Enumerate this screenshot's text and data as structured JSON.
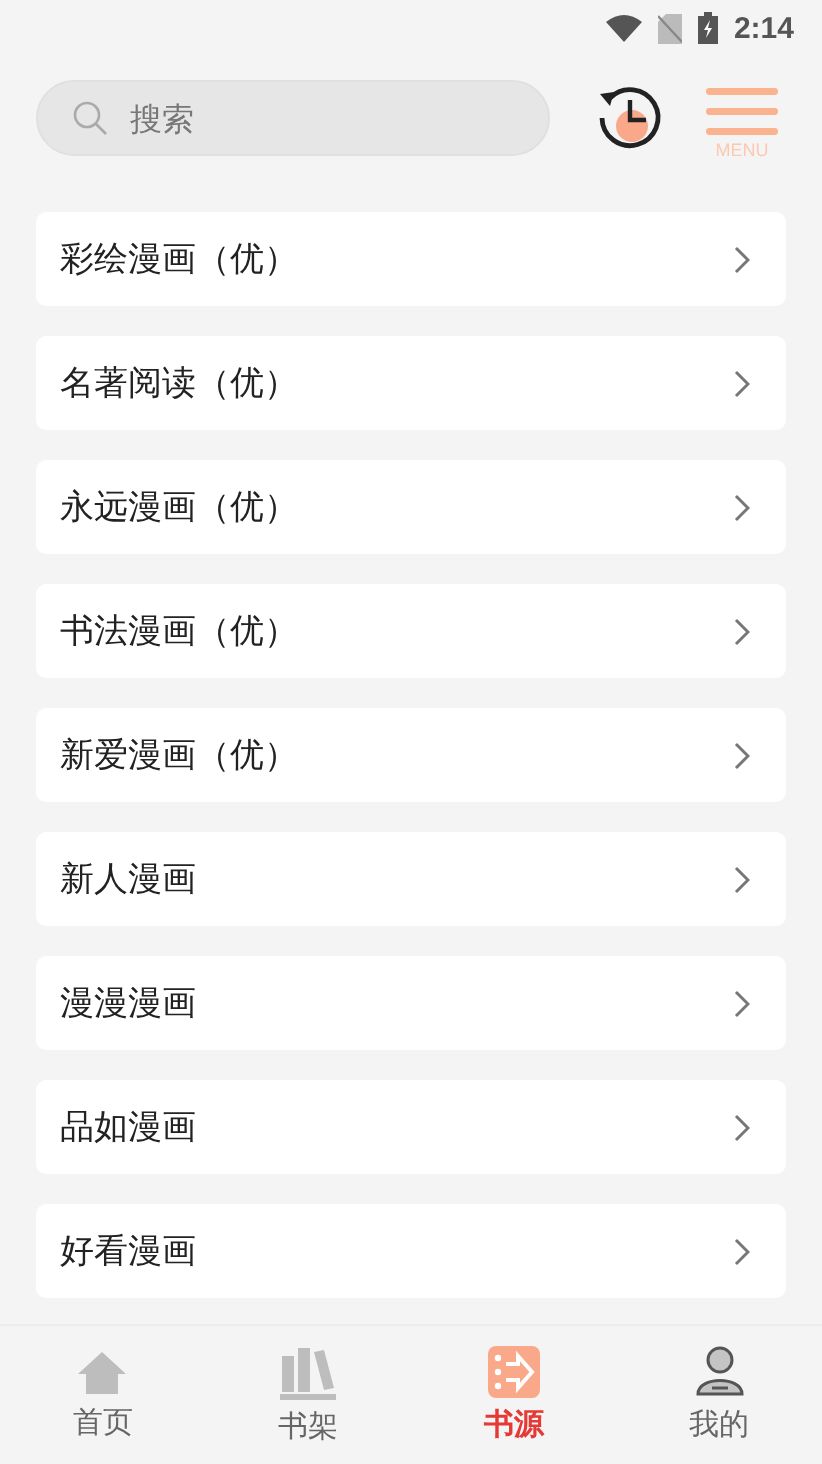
{
  "status_bar": {
    "time": "2:14"
  },
  "search": {
    "placeholder": "搜索"
  },
  "menu_button": {
    "label": "MENU"
  },
  "sources": [
    {
      "name": "彩绘漫画（优）"
    },
    {
      "name": "名著阅读（优）"
    },
    {
      "name": "永远漫画（优）"
    },
    {
      "name": "书法漫画（优）"
    },
    {
      "name": "新爱漫画（优）"
    },
    {
      "name": "新人漫画"
    },
    {
      "name": "漫漫漫画"
    },
    {
      "name": "品如漫画"
    },
    {
      "name": "好看漫画"
    }
  ],
  "bottom_nav": [
    {
      "label": "首页",
      "kind": "home",
      "selected": false
    },
    {
      "label": "书架",
      "kind": "shelf",
      "selected": false
    },
    {
      "label": "书源",
      "kind": "source",
      "selected": true
    },
    {
      "label": "我的",
      "kind": "profile",
      "selected": false
    }
  ]
}
